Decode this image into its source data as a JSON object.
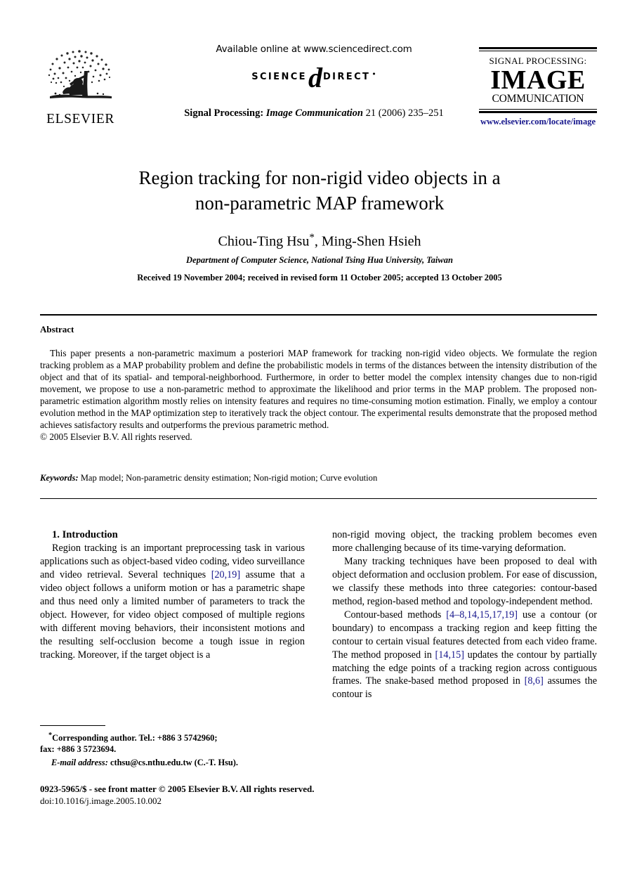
{
  "masthead": {
    "available_online": "Available online at www.sciencedirect.com",
    "sciencedirect": {
      "science": "SCIENCE",
      "d": "d",
      "direct": "DIRECT",
      "registered": "•"
    },
    "publisher_logo_text": "ELSEVIER",
    "journal_reference": {
      "name": "Signal Processing:",
      "italic_part": "Image Communication",
      "rest": " 21 (2006) 235–251"
    },
    "journal_logo": {
      "line1": "SIGNAL PROCESSING:",
      "line2": "IMAGE",
      "line3": "COMMUNICATION",
      "url": "www.elsevier.com/locate/image",
      "url_color": "#16168c"
    }
  },
  "article": {
    "title_line1": "Region tracking for non-rigid video objects in a",
    "title_line2": "non-parametric MAP framework",
    "authors": "Chiou-Ting Hsu",
    "authors_marker": "*",
    "authors_rest": ", Ming-Shen Hsieh",
    "affiliation": "Department of Computer Science, National Tsing Hua University, Taiwan",
    "dates": "Received 19 November 2004; received in revised form 11 October 2005; accepted 13 October 2005"
  },
  "abstract": {
    "heading": "Abstract",
    "body": "This paper presents a non-parametric maximum a posteriori MAP framework for tracking non-rigid video objects. We formulate the region tracking problem as a MAP probability problem and define the probabilistic models in terms of the distances between the intensity distribution of the object and that of its spatial- and temporal-neighborhood. Furthermore, in order to better model the complex intensity changes due to non-rigid movement, we propose to use a non-parametric method to approximate the likelihood and prior terms in the MAP problem. The proposed non-parametric estimation algorithm mostly relies on intensity features and requires no time-consuming motion estimation. Finally, we employ a contour evolution method in the MAP optimization step to iteratively track the object contour. The experimental results demonstrate that the proposed method achieves satisfactory results and outperforms the previous parametric method.",
    "copyright": "© 2005 Elsevier B.V. All rights reserved.",
    "keywords_label": "Keywords:",
    "keywords_value": " Map model; Non-parametric density estimation; Non-rigid motion; Curve evolution"
  },
  "body": {
    "section_heading": "1.  Introduction",
    "left_column": {
      "para1_a": "Region tracking is an important preprocessing task in various applications such as object-based video coding, video surveillance and video retrieval. Several techniques ",
      "para1_cite1": "[20,19]",
      "para1_b": " assume that a video object follows a uniform motion or has a parametric shape and thus need only a limited number of parameters to track the object. However, for video object composed of multiple regions with different moving behaviors, their inconsistent motions and the resulting self-occlusion become a tough issue in region tracking. Moreover, if the target object is a"
    },
    "right_column": {
      "para1": "non-rigid moving object, the tracking problem becomes even more challenging because of its time-varying deformation.",
      "para2": "Many tracking techniques have been proposed to deal with object deformation and occlusion problem. For ease of discussion, we classify these methods into three categories: contour-based method, region-based method and topology-independent method.",
      "para3_a": "Contour-based methods ",
      "para3_cite1": "[4–8,14,15,17,19]",
      "para3_b": " use a contour (or boundary) to encompass a tracking region and keep fitting the contour to certain visual features detected from each video frame. The method proposed in ",
      "para3_cite2": "[14,15]",
      "para3_c": " updates the contour by partially matching the edge points of a tracking region across contiguous frames. The snake-based method proposed in ",
      "para3_cite3": "[8,6]",
      "para3_d": " assumes the contour is"
    },
    "citation_color": "#16168c"
  },
  "footnotes": {
    "corresponding_marker": "*",
    "corresponding": "Corresponding author. Tel.: +886 3 5742960;",
    "fax": "fax: +886 3 5723694.",
    "email_label": "E-mail address:",
    "email_value": " cthsu@cs.nthu.edu.tw (C.-T. Hsu).",
    "imprint_line1": "0923-5965/$ - see front matter © 2005 Elsevier B.V. All rights reserved.",
    "imprint_line2": "doi:10.1016/j.image.2005.10.002"
  }
}
